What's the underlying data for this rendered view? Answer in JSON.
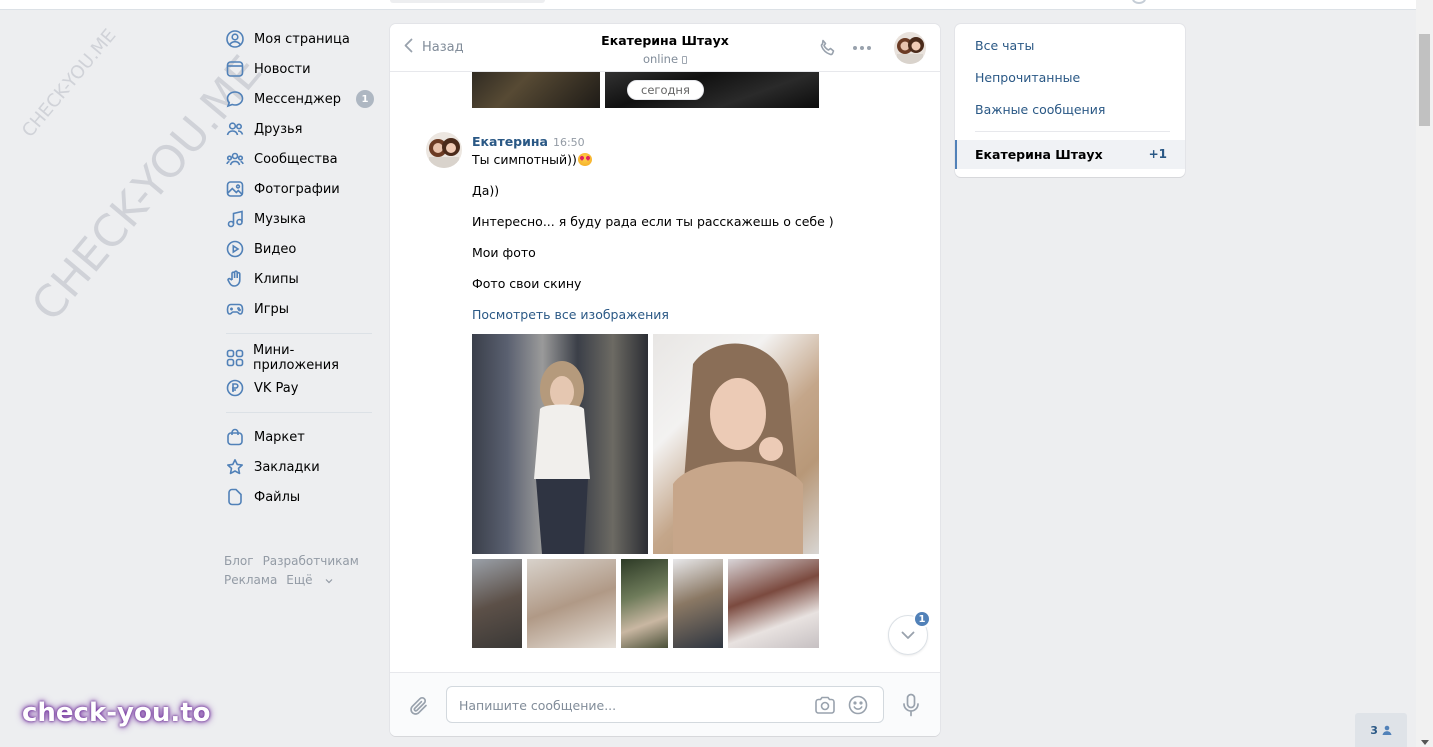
{
  "colors": {
    "link": "#2a5885",
    "accent": "#5181b8",
    "bg": "#edeef0",
    "muted": "#818c99"
  },
  "watermarks": {
    "small": "CHECK-YOU.ME",
    "large": "CHECK-YOU.ME",
    "brand": "check-you.to"
  },
  "leftnav": {
    "items": [
      {
        "label": "Моя страница",
        "icon": "user-circle-icon"
      },
      {
        "label": "Новости",
        "icon": "newspaper-icon"
      },
      {
        "label": "Мессенджер",
        "icon": "message-icon",
        "badge": "1"
      },
      {
        "label": "Друзья",
        "icon": "friends-icon"
      },
      {
        "label": "Сообщества",
        "icon": "communities-icon"
      },
      {
        "label": "Фотографии",
        "icon": "photo-icon"
      },
      {
        "label": "Музыка",
        "icon": "music-icon"
      },
      {
        "label": "Видео",
        "icon": "video-icon"
      },
      {
        "label": "Клипы",
        "icon": "clips-icon"
      },
      {
        "label": "Игры",
        "icon": "gamepad-icon"
      }
    ],
    "items2": [
      {
        "label": "Мини-приложения",
        "icon": "apps-icon"
      },
      {
        "label": "VK Pay",
        "icon": "vkpay-icon"
      }
    ],
    "items3": [
      {
        "label": "Маркет",
        "icon": "market-icon"
      },
      {
        "label": "Закладки",
        "icon": "star-icon"
      },
      {
        "label": "Файлы",
        "icon": "file-icon"
      }
    ],
    "footer": {
      "blog": "Блог",
      "dev": "Разработчикам",
      "ads": "Реклама",
      "more": "Ещё"
    }
  },
  "chat": {
    "back_label": "Назад",
    "title": "Екатерина Штаух",
    "status": "online",
    "date_divider": "сегодня",
    "message": {
      "author": "Екатерина",
      "time": "16:50",
      "lines": [
        "Ты симпотный))",
        "Да))",
        "Интересно... я буду рада если ты расскажешь о себе )",
        "Мои фото",
        "Фото свои скину"
      ],
      "view_all": "Посмотреть все изображения"
    },
    "unread_count": "1",
    "composer_placeholder": "Напишите сообщение..."
  },
  "rightpanel": {
    "all_chats": "Все чаты",
    "unread": "Непрочитанные",
    "important": "Важные сообщения",
    "active_chat": "Екатерина Штаух",
    "active_count": "+1"
  },
  "bottom_widget": "3"
}
